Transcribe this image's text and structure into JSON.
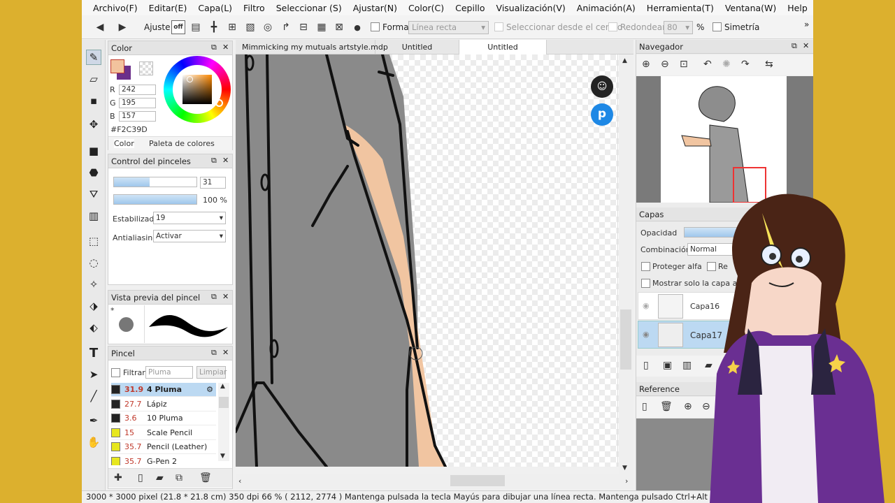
{
  "menu": [
    "Archivo(F)",
    "Editar(E)",
    "Capa(L)",
    "Filtro",
    "Seleccionar (S)",
    "Ajustar(N)",
    "Color(C)",
    "Cepillo",
    "Visualización(V)",
    "Animación(A)",
    "Herramienta(T)",
    "Ventana(W)",
    "Help"
  ],
  "toolbar": {
    "ajuste": "Ajuste",
    "off": "off",
    "forma": "Forma",
    "forma_value": "Línea recta",
    "select_center": "Seleccionar desde el centro",
    "redondear": "Redondear",
    "redondear_value": "80",
    "percent": "%",
    "simetria": "Simetría"
  },
  "color_panel": {
    "title": "Color",
    "r_label": "R",
    "g_label": "G",
    "b_label": "B",
    "r": "242",
    "g": "195",
    "b": "157",
    "hex": "#F2C39D",
    "tab_color": "Color",
    "tab_palette": "Paleta de colores",
    "current_color": "#f2c39d",
    "secondary_color": "#6b2f8a"
  },
  "brush_control": {
    "title": "Control del pinceles",
    "size": "31",
    "opacity": "100 %",
    "size_fraction": 0.43,
    "opacity_fraction": 1.0,
    "stabilizer_label": "Estabilizad",
    "stabilizer": "19",
    "antialias_label": "Antialiasinç",
    "antialias": "Activar"
  },
  "brush_preview": {
    "title": "Vista previa del pincel",
    "star": "*"
  },
  "brushes": {
    "title": "Pincel",
    "filter_label": "Filtrar",
    "filter_placeholder": "Pluma",
    "clear": "Limpiar",
    "items": [
      {
        "size": "31.9",
        "name": "4 Pluma",
        "color": "#222222",
        "selected": true
      },
      {
        "size": "27.7",
        "name": "Lápiz",
        "color": "#222222"
      },
      {
        "size": "3.6",
        "name": "10 Pluma",
        "color": "#222222"
      },
      {
        "size": "15",
        "name": "Scale Pencil",
        "color": "#e7e71e"
      },
      {
        "size": "35.7",
        "name": "Pencil (Leather)",
        "color": "#e7e71e"
      },
      {
        "size": "35.7",
        "name": "G-Pen 2",
        "color": "#e7e71e"
      }
    ]
  },
  "tabs": [
    {
      "label": "Mimmicking my mutuals artstyle.mdp"
    },
    {
      "label": "Untitled"
    },
    {
      "label": "Untitled",
      "active": true
    }
  ],
  "navigator": {
    "title": "Navegador"
  },
  "layers": {
    "title": "Capas",
    "opacity_label": "Opacidad",
    "blend_label": "Combinación",
    "blend_value": "Normal",
    "protect_alpha": "Proteger alfa",
    "re": "Re",
    "show_only": "Mostrar solo la capa activa",
    "items": [
      {
        "name": "Capa16"
      },
      {
        "name": "Capa17",
        "selected": true
      }
    ]
  },
  "reference": {
    "title": "Reference"
  },
  "status": "3000 * 3000 pixel   (21.8 * 21.8 cm)   350 dpi   66 %   ( 2112, 2774 )   Mantenga pulsada la tecla Mayús para dibujar una línea recta. Mantenga pulsado Ctrl+Alt y arrastre"
}
